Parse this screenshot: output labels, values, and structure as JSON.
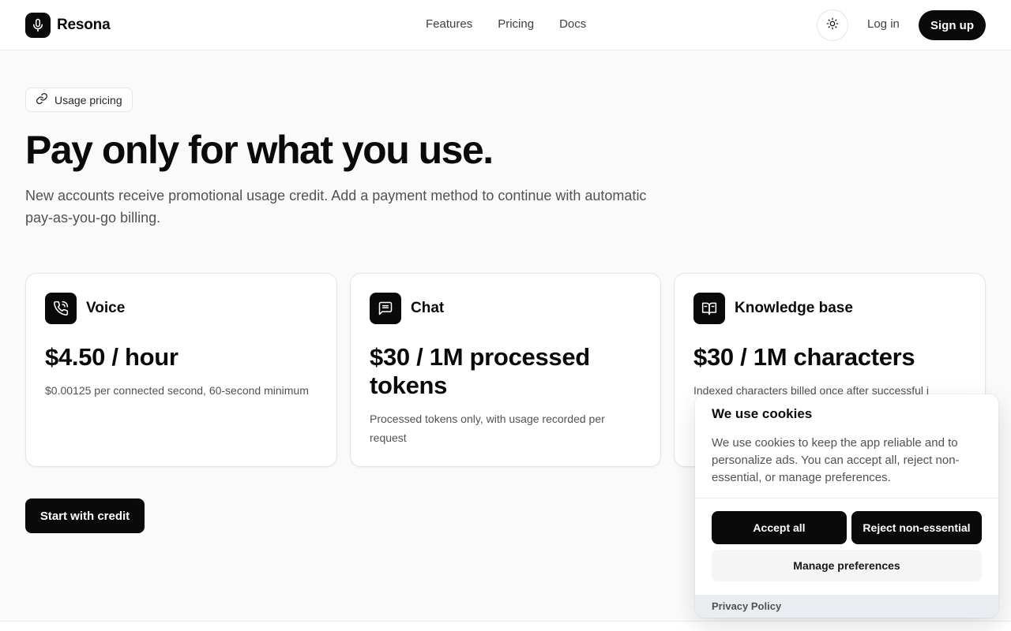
{
  "brand": {
    "name": "Resona",
    "logo_icon": "microphone-icon"
  },
  "nav": {
    "items": [
      "Features",
      "Pricing",
      "Docs"
    ]
  },
  "header": {
    "theme_icon": "sun-icon",
    "login_label": "Log in",
    "signup_label": "Sign up"
  },
  "hero": {
    "badge_icon": "link-icon",
    "badge_label": "Usage pricing",
    "title": "Pay only for what you use.",
    "subtitle": "New accounts receive promotional usage credit. Add a payment method to continue with automatic pay-as-you-go billing."
  },
  "cards": [
    {
      "icon": "phone-call-icon",
      "title": "Voice",
      "price": "$4.50 / hour",
      "description": "$0.00125 per connected second, 60-second minimum"
    },
    {
      "icon": "message-square-icon",
      "title": "Chat",
      "price": "$30 / 1M processed tokens",
      "description": "Processed tokens only, with usage recorded per request"
    },
    {
      "icon": "book-open-icon",
      "title": "Knowledge base",
      "price": "$30 / 1M characters",
      "description": "Indexed characters billed once after successful i"
    }
  ],
  "cta": {
    "label": "Start with credit"
  },
  "cookie": {
    "title": "We use cookies",
    "text": "We use cookies to keep the app reliable and to personalize ads. You can accept all, reject non-essential, or manage preferences.",
    "accept_label": "Accept all",
    "reject_label": "Reject non-essential",
    "manage_label": "Manage preferences",
    "privacy_label": "Privacy Policy"
  },
  "colors": {
    "primary": "#0a0a0a",
    "background": "#fafafa",
    "muted_text": "#525252"
  }
}
